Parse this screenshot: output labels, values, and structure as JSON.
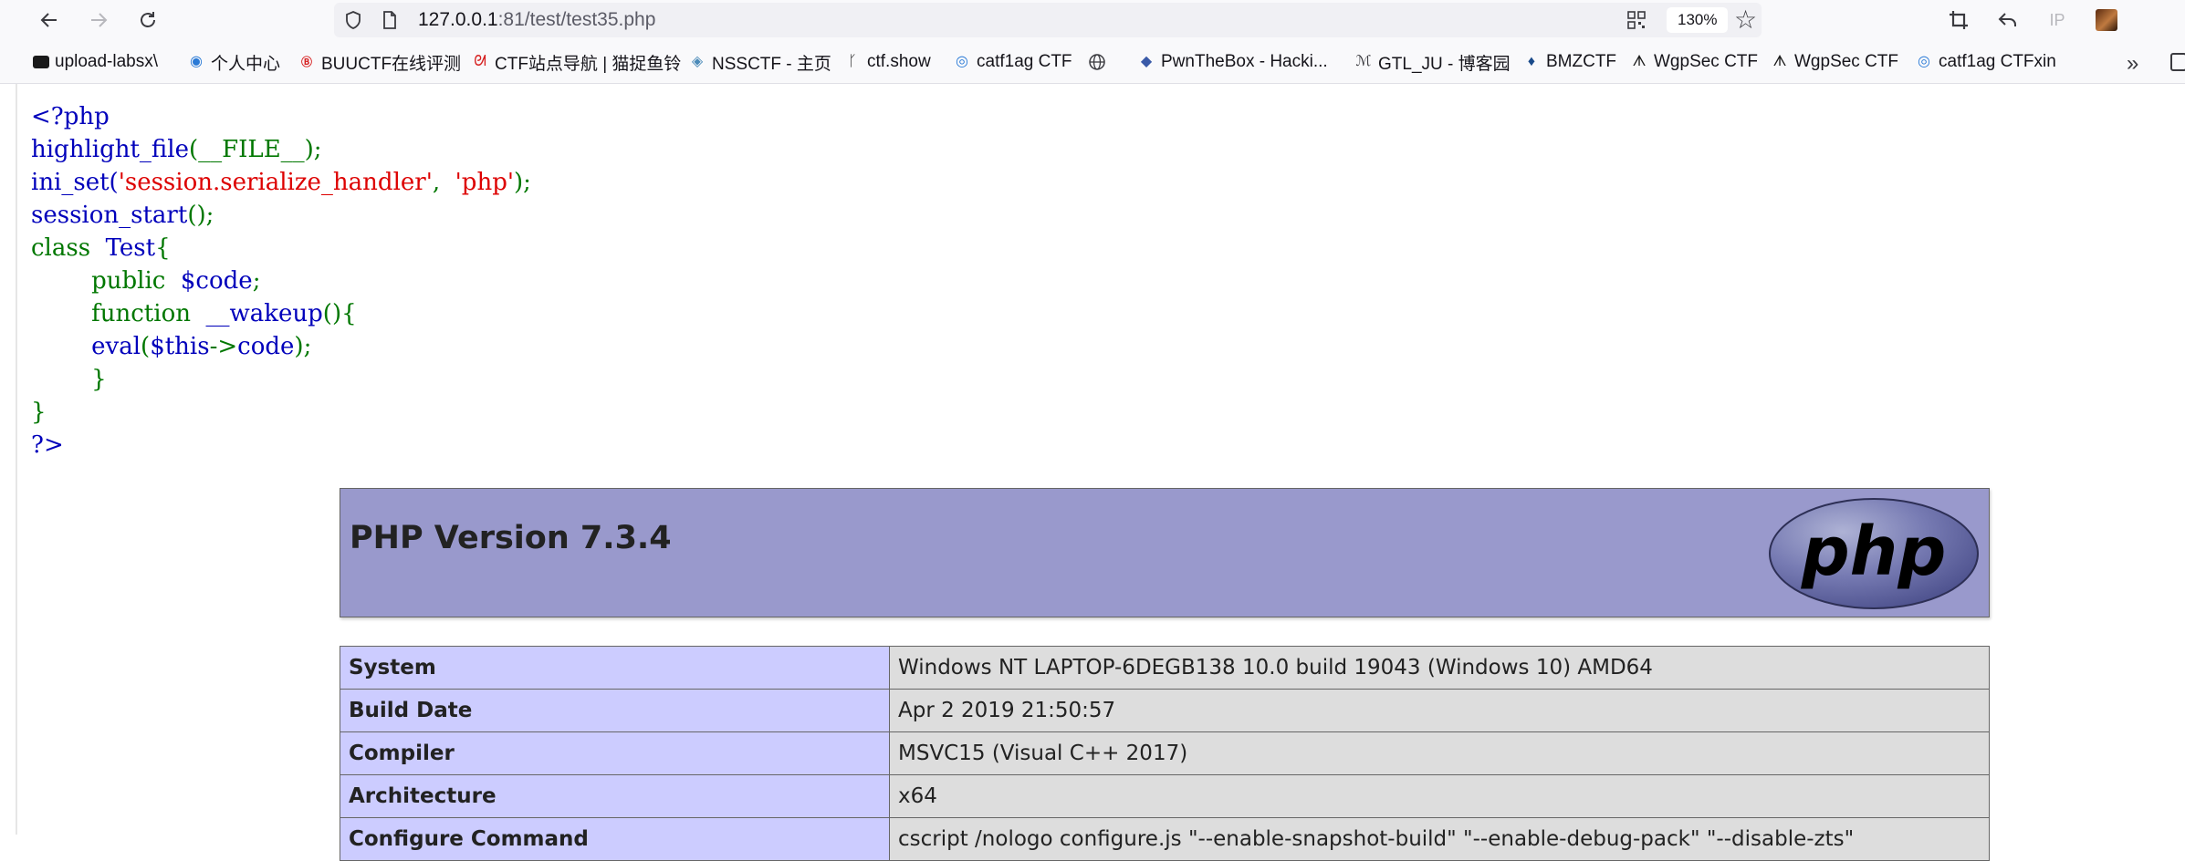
{
  "browser": {
    "url_host": "127.0.0.1",
    "url_rest": ":81/test/test35.php",
    "zoom": "130%",
    "ip_label": "IP"
  },
  "bookmarks": [
    {
      "label": "upload-labsx\\",
      "icon": "folder-icon"
    },
    {
      "label": "个人中心",
      "icon": "swirl-icon"
    },
    {
      "label": "BUUCTF在线评测",
      "icon": "buu-icon"
    },
    {
      "label": "CTF站点导航 | 猫捉鱼铃",
      "icon": "cat-icon"
    },
    {
      "label": "NSSCTF - 主页",
      "icon": "nss-icon"
    },
    {
      "label": "ctf.show",
      "icon": "runner-icon"
    },
    {
      "label": "catf1ag CTF",
      "icon": "eye-icon"
    },
    {
      "label": "",
      "icon": "globe-icon"
    },
    {
      "label": "PwnTheBox - Hacki...",
      "icon": "box-icon"
    },
    {
      "label": "GTL_JU - 博客园",
      "icon": "cnblogs-icon"
    },
    {
      "label": "BMZCTF",
      "icon": "drop-icon"
    },
    {
      "label": "WgpSec CTF",
      "icon": "wolf-icon"
    },
    {
      "label": "WgpSec CTF",
      "icon": "wolf-icon"
    },
    {
      "label": "catf1ag CTFxin",
      "icon": "eye-icon"
    }
  ],
  "source_code": {
    "line1": "<?php",
    "line2_fn": "highlight_file",
    "line2_rest": "(__FILE__);",
    "line3_fn": "ini_set(",
    "line3_str1": "'session.serialize_handler'",
    "line3_sep": ",  ",
    "line3_str2": "'php'",
    "line3_end": ");",
    "line4_fn": "session_start",
    "line4_rest": "();",
    "line5_kw": "class  ",
    "line5_name": "Test",
    "line5_brace": "{",
    "line6_kw": "public  ",
    "line6_var": "$code",
    "line6_end": ";",
    "line7_kw": "function  ",
    "line7_name": "__wakeup",
    "line7_end": "(){",
    "line8_fn": "eval",
    "line8_open": "(",
    "line8_var": "$this",
    "line8_arrow": "->",
    "line8_prop": "code",
    "line8_end": ");",
    "line9": "}",
    "line10": "}",
    "line11": "?>"
  },
  "phpinfo": {
    "version_title": "PHP Version 7.3.4",
    "logo_text": "php",
    "rows": [
      {
        "key": "System",
        "value": "Windows NT LAPTOP-6DEGB138 10.0 build 19043 (Windows 10) AMD64"
      },
      {
        "key": "Build Date",
        "value": "Apr 2 2019 21:50:57"
      },
      {
        "key": "Compiler",
        "value": "MSVC15 (Visual C++ 2017)"
      },
      {
        "key": "Architecture",
        "value": "x64"
      },
      {
        "key": "Configure Command",
        "value": "cscript /nologo configure.js \"--enable-snapshot-build\" \"--enable-debug-pack\" \"--disable-zts\""
      }
    ]
  },
  "colors": {
    "php_header_bg": "#9999cc",
    "table_key_bg": "#ccccff",
    "table_value_bg": "#dddddd",
    "code_blue": "#0000bb",
    "code_green": "#007700",
    "code_red": "#dd0000"
  }
}
